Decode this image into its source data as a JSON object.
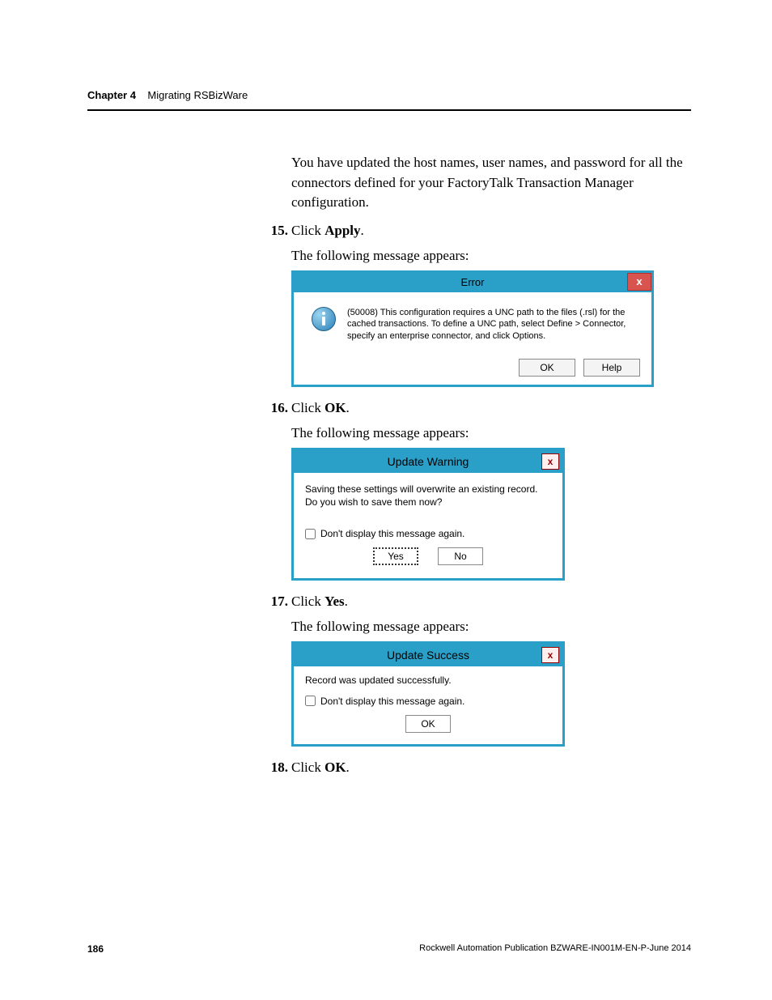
{
  "header": {
    "chapter": "Chapter 4",
    "title": "Migrating RSBizWare"
  },
  "intro": "You have updated the host names, user names, and password for all the connectors defined for your FactoryTalk Transaction Manager configuration.",
  "steps": {
    "s15_num": "15.",
    "s15_pre": "Click ",
    "s15_bold": "Apply",
    "s15_post": ".",
    "s15_follow": "The following message appears:",
    "s16_num": "16.",
    "s16_pre": "Click ",
    "s16_bold": "OK",
    "s16_post": ".",
    "s16_follow": "The following message appears:",
    "s17_num": "17.",
    "s17_pre": "Click ",
    "s17_bold": "Yes",
    "s17_post": ".",
    "s17_follow": "The following message appears:",
    "s18_num": "18.",
    "s18_pre": "Click ",
    "s18_bold": "OK",
    "s18_post": "."
  },
  "dialog1": {
    "title": "Error",
    "close": "x",
    "message": "(50008) This configuration requires a UNC path to the files (.rsl) for the cached transactions. To define a UNC path, select Define > Connector, specify an enterprise connector, and click Options.",
    "ok": "OK",
    "help": "Help"
  },
  "dialog2": {
    "title": "Update Warning",
    "close": "x",
    "message": "Saving these settings will overwrite an existing record. Do you wish to save them now?",
    "checkbox": "Don't display this message again.",
    "yes": "Yes",
    "no": "No"
  },
  "dialog3": {
    "title": "Update Success",
    "close": "x",
    "message": "Record was updated successfully.",
    "checkbox": "Don't display this message again.",
    "ok": "OK"
  },
  "footer": {
    "page": "186",
    "pub": "Rockwell Automation Publication BZWARE-IN001M-EN-P-June 2014"
  }
}
